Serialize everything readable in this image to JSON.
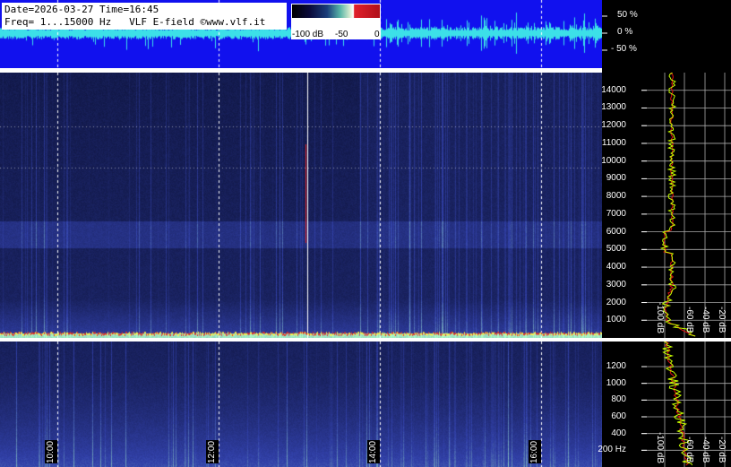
{
  "info": {
    "line1": "Date=2026-03-27 Time=16:45",
    "line2": "Freq= 1...15000 Hz   VLF E-field ©www.vlf.it"
  },
  "colorbar": {
    "ticks": [
      "-100 dB",
      "-50",
      "0"
    ]
  },
  "waveform": {
    "pct_labels": [
      "50 %",
      "0 %",
      "- 50 %"
    ]
  },
  "time_labels": [
    "10:00",
    "12:00",
    "14:00",
    "16:00"
  ],
  "profile_db_labels": [
    "-100 dB",
    "-60 dB",
    "-40 dB",
    "-20 dB"
  ],
  "colors": {
    "wave_bg": "#1111ee",
    "wave_line": "#3ce0e8",
    "spec_bg": "#141d55",
    "profile_green": "#c8ff00",
    "profile_red": "#e01010",
    "grid": "#ffffff"
  },
  "chart_data": [
    {
      "type": "heatmap",
      "title": "",
      "xlabel": "",
      "ylabel": "",
      "x": [
        "10:00",
        "12:00",
        "14:00",
        "16:00"
      ],
      "ylim": [
        0,
        15000
      ],
      "y_ticks": [
        1000,
        2000,
        3000,
        4000,
        5000,
        6000,
        7000,
        8000,
        9000,
        10000,
        11000,
        12000,
        13000,
        14000
      ],
      "colorscale_db": [
        -100,
        0
      ]
    },
    {
      "type": "heatmap",
      "title": "",
      "xlabel": "",
      "ylabel": "",
      "x": [
        "10:00",
        "12:00",
        "14:00",
        "16:00"
      ],
      "ylim": [
        0,
        1500
      ],
      "y_ticks": [
        200,
        400,
        600,
        800,
        1000,
        1200
      ],
      "y_tick_labels": [
        "200 Hz",
        "400",
        "600",
        "800",
        "1000",
        "1200"
      ],
      "colorscale_db": [
        -100,
        0
      ]
    },
    {
      "type": "line",
      "title": "",
      "xlim_db": [
        -100,
        -20
      ],
      "x_ticks": [
        "-100 dB",
        "-60 dB",
        "-40 dB",
        "-20 dB"
      ],
      "y_ticks": [
        1000,
        2000,
        3000,
        4000,
        5000,
        6000,
        7000,
        8000,
        9000,
        10000,
        11000,
        12000,
        13000,
        14000
      ],
      "series": []
    }
  ]
}
